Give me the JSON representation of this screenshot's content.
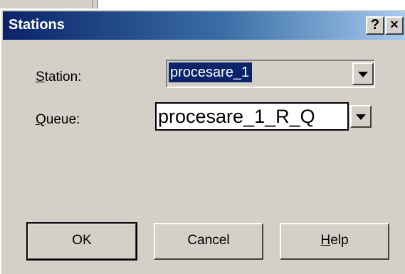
{
  "dialog": {
    "title": "Stations",
    "help_button": "?",
    "close_button": "×"
  },
  "form": {
    "station_label_ul": "S",
    "station_label_rest": "tation:",
    "station_value": "procesare_1",
    "queue_label_ul": "Q",
    "queue_label_rest": "ueue:",
    "queue_value": "procesare_1_R_Q"
  },
  "buttons": {
    "ok": "OK",
    "cancel": "Cancel",
    "help_ul": "H",
    "help_rest": "elp"
  }
}
